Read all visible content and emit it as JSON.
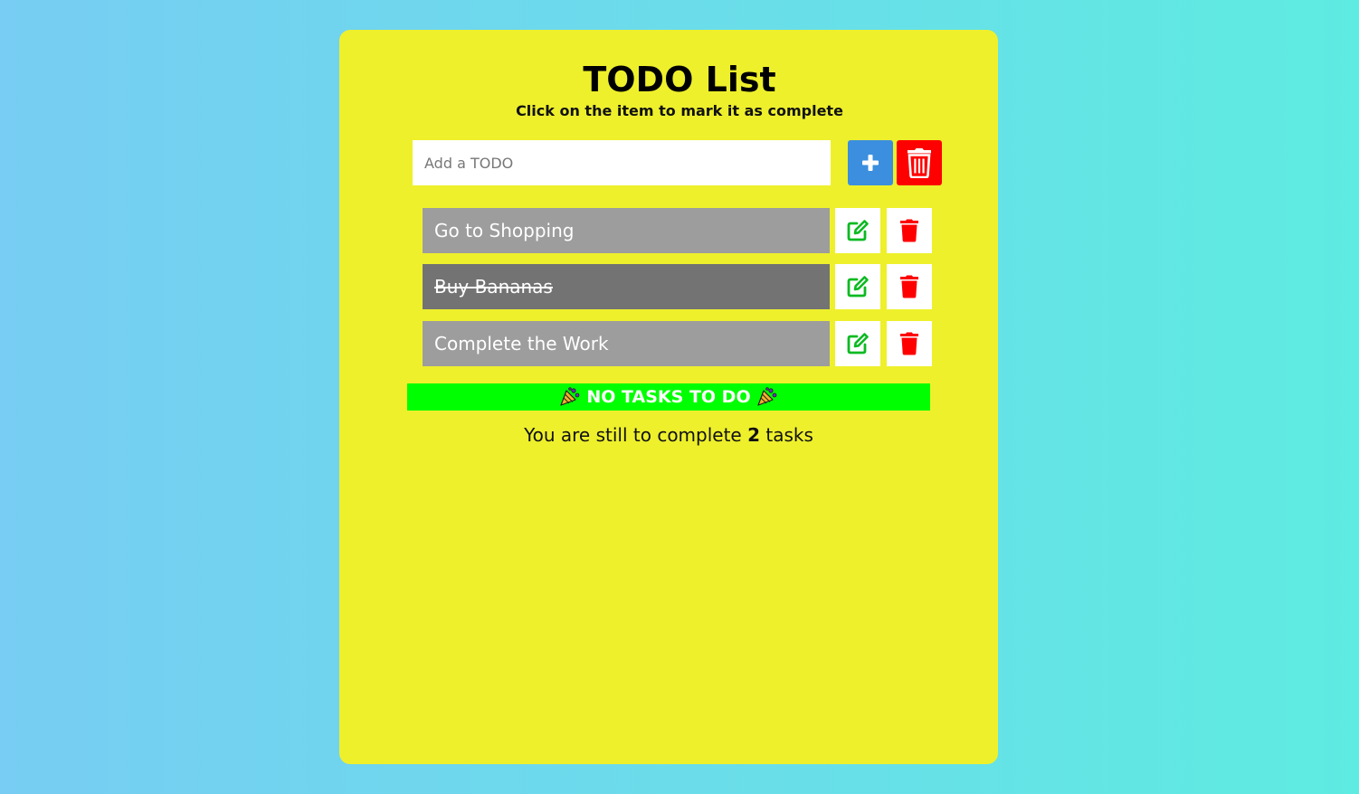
{
  "app": {
    "title": "TODO List",
    "subtitle": "Click on the item to mark it as complete"
  },
  "input": {
    "placeholder": "Add a TODO",
    "value": ""
  },
  "buttons": {
    "add_icon": "plus-icon",
    "clear_all_icon": "trash-icon"
  },
  "todos": [
    {
      "label": "Go to Shopping",
      "completed": false
    },
    {
      "label": "Buy Bananas",
      "completed": true
    },
    {
      "label": "Complete the Work",
      "completed": false
    }
  ],
  "banner": {
    "text": "NO TASKS TO DO",
    "icon": "party-popper-icon"
  },
  "counter": {
    "prefix": "You are still to complete",
    "count": "2",
    "suffix": "tasks"
  },
  "colors": {
    "background_from": "#77cdf3",
    "background_to": "#5eebe1",
    "card": "#eef02c",
    "add_button": "#3b8fde",
    "clear_button": "#ff0000",
    "item": "#9d9d9d",
    "item_completed": "#737373",
    "edit_icon": "#0cba22",
    "delete_icon": "#ff0000",
    "banner": "#00ff00"
  }
}
